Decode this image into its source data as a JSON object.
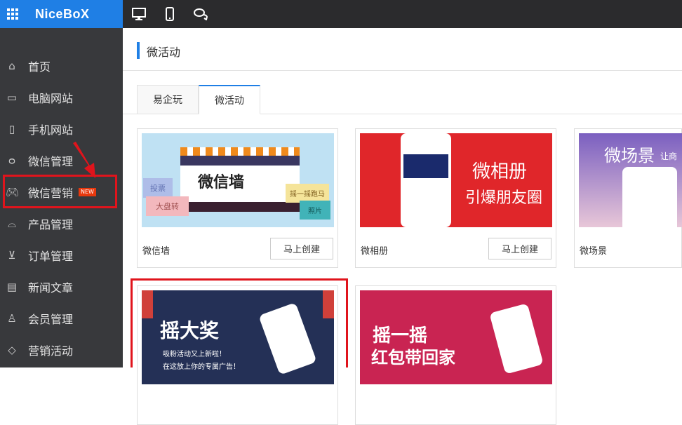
{
  "brand": "NiceBoX",
  "header": {
    "title": "微活动"
  },
  "sidebar": {
    "items": [
      {
        "label": "首页",
        "icon": "home-icon"
      },
      {
        "label": "电脑网站",
        "icon": "desktop-icon"
      },
      {
        "label": "手机网站",
        "icon": "mobile-icon"
      },
      {
        "label": "微信管理",
        "icon": "chat-icon"
      },
      {
        "label": "微信营销",
        "icon": "gamepad-icon",
        "badge": "NEW"
      },
      {
        "label": "产品管理",
        "icon": "bag-icon"
      },
      {
        "label": "订单管理",
        "icon": "cart-icon"
      },
      {
        "label": "新闻文章",
        "icon": "document-icon"
      },
      {
        "label": "会员管理",
        "icon": "user-icon"
      },
      {
        "label": "营销活动",
        "icon": "tag-icon"
      }
    ]
  },
  "tabs": [
    {
      "label": "易企玩"
    },
    {
      "label": "微活动"
    }
  ],
  "cards": [
    {
      "label": "微信墙",
      "button": "马上创建",
      "img_title": "微信墙",
      "tags": [
        "投票",
        "大盘转",
        "摇一摇跑马",
        "照片"
      ]
    },
    {
      "label": "微相册",
      "button": "马上创建",
      "img_title": "微相册",
      "img_sub": "引爆朋友圈"
    },
    {
      "label": "微场景",
      "img_title": "微场景",
      "img_sub": "让商"
    },
    {
      "img_title": "摇大奖",
      "img_sub1": "吸粉活动又上新啦！",
      "img_sub2": "在这放上你的专属广告！"
    },
    {
      "img_title": "摇一摇",
      "img_sub": "红包带回家"
    }
  ]
}
